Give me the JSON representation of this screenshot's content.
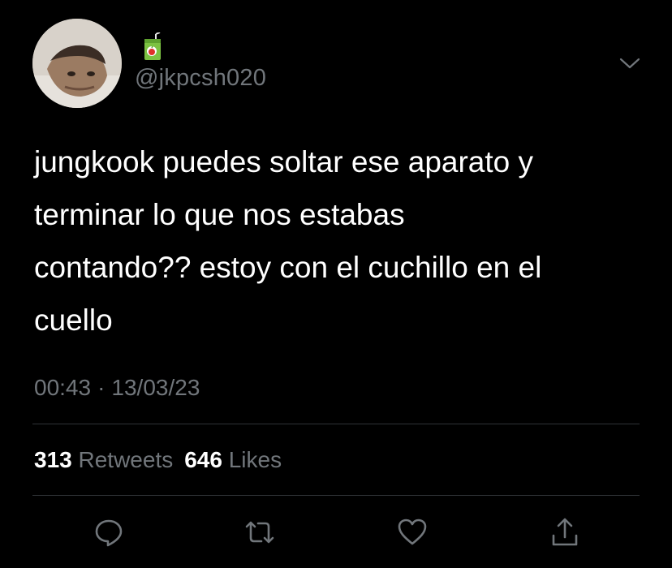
{
  "user": {
    "handle": "@jkpcsh020",
    "avatar_icon": "profile-photo",
    "badge_icon": "juice-box-icon"
  },
  "tweet": {
    "text": "jungkook puedes soltar ese aparato y\nterminar lo que nos estabas\ncontando?? estoy con el cuchillo en el\ncuello",
    "time": "00:43",
    "separator": "·",
    "date": "13/03/23"
  },
  "stats": {
    "retweets_count": "313",
    "retweets_label": "Retweets",
    "likes_count": "646",
    "likes_label": "Likes"
  },
  "actions": [
    "reply-icon",
    "retweet-icon",
    "like-icon",
    "share-icon"
  ],
  "colors": {
    "background": "#000000",
    "text": "#ffffff",
    "secondary": "#71767b",
    "divider": "#2f3336"
  }
}
